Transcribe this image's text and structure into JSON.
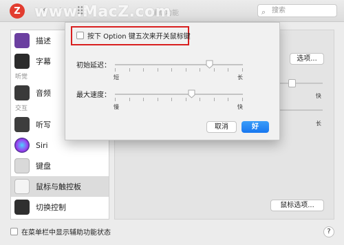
{
  "titlebar": {
    "logo_letter": "Z",
    "back_icon": "chevron-left-icon",
    "forward_icon": "chevron-right-icon",
    "window_title": "辅助功能",
    "watermark": "www.MacZ.com",
    "search_placeholder": "搜索"
  },
  "sidebar": {
    "items": [
      {
        "label": "描述",
        "icon": "descriptions-icon",
        "color": "#6b3fa0"
      },
      {
        "label": "字幕",
        "icon": "captions-icon",
        "color": "#2b2b2b"
      },
      {
        "category": "听觉"
      },
      {
        "label": "音频",
        "icon": "speaker-icon",
        "color": "#3a3a3a"
      },
      {
        "category": "交互"
      },
      {
        "label": "听写",
        "icon": "dictation-icon",
        "color": "#3d3d3d"
      },
      {
        "label": "Siri",
        "icon": "siri-icon",
        "color": "#1d2a5a"
      },
      {
        "label": "键盘",
        "icon": "keyboard-icon",
        "color": "#d9d9d9"
      },
      {
        "label": "鼠标与触控板",
        "icon": "mouse-icon",
        "color": "#e8e8e8",
        "selected": true
      },
      {
        "label": "切换控制",
        "icon": "switch-control-icon",
        "color": "#2f2f2f"
      }
    ]
  },
  "right_panel": {
    "options_button": "选项...",
    "mouse_options_button": "鼠标选项...",
    "label_fast": "快",
    "label_long": "长"
  },
  "bottom": {
    "menu_bar_checkbox_label": "在菜单栏中显示辅助功能状态",
    "help": "?"
  },
  "sheet": {
    "option_checkbox_label": "按下 Option 键五次来开关鼠标键",
    "initial_delay_label": "初始延迟：",
    "initial_delay_min": "短",
    "initial_delay_max": "长",
    "initial_delay_value": 0.74,
    "max_speed_label": "最大速度：",
    "max_speed_min": "慢",
    "max_speed_max": "快",
    "max_speed_value": 0.6,
    "cancel_button": "取消",
    "ok_button": "好",
    "highlight_color": "#d81e1e",
    "accent_color": "#1877f0"
  }
}
